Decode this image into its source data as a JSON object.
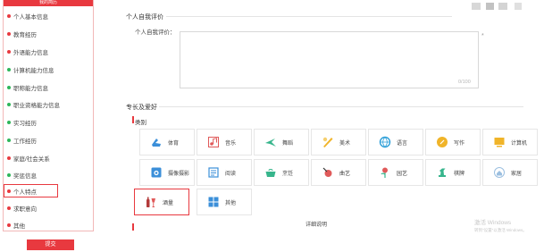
{
  "sidebar": {
    "header": "我的简历",
    "items": [
      {
        "label": "个人基本信息",
        "dot": "red"
      },
      {
        "label": "教育经历",
        "dot": "red"
      },
      {
        "label": "外语能力信息",
        "dot": "red"
      },
      {
        "label": "计算机能力信息",
        "dot": "green"
      },
      {
        "label": "职称能力信息",
        "dot": "green"
      },
      {
        "label": "职业资格能力信息",
        "dot": "green"
      },
      {
        "label": "实习经历",
        "dot": "green"
      },
      {
        "label": "工作经历",
        "dot": "green"
      },
      {
        "label": "家庭/社会关系",
        "dot": "red"
      },
      {
        "label": "奖惩信息",
        "dot": "green"
      },
      {
        "label": "个人特点",
        "dot": "red",
        "active": true
      },
      {
        "label": "求职意向",
        "dot": "red"
      },
      {
        "label": "其他",
        "dot": "red"
      }
    ],
    "submit_label": "提交"
  },
  "self_evaluation": {
    "section_title": "个人自我评价",
    "field_label": "个人自我评价：",
    "value": "",
    "char_count": "0/100",
    "required_mark": "*"
  },
  "hobbies": {
    "section_title": "专长及爱好",
    "category_label": "类别",
    "detail_label": "详细说明",
    "tiles": [
      {
        "label": "体育",
        "icon": "sports-icon",
        "color": "#3b8fd9"
      },
      {
        "label": "音乐",
        "icon": "music-icon",
        "color": "#e05a5a"
      },
      {
        "label": "舞蹈",
        "icon": "dance-icon",
        "color": "#37b58c"
      },
      {
        "label": "美术",
        "icon": "art-icon",
        "color": "#f0b429"
      },
      {
        "label": "语言",
        "icon": "language-icon",
        "color": "#2d9fd8"
      },
      {
        "label": "写作",
        "icon": "writing-icon",
        "color": "#f0b429"
      },
      {
        "label": "计算机",
        "icon": "computer-icon",
        "color": "#f0b429"
      },
      {
        "label": "摄像摄影",
        "icon": "camera-icon",
        "color": "#3b8fd9"
      },
      {
        "label": "阅读",
        "icon": "reading-icon",
        "color": "#3b8fd9"
      },
      {
        "label": "烹饪",
        "icon": "cooking-icon",
        "color": "#37b58c"
      },
      {
        "label": "曲艺",
        "icon": "opera-icon",
        "color": "#e05a5a"
      },
      {
        "label": "园艺",
        "icon": "gardening-icon",
        "color": "#e05a5a"
      },
      {
        "label": "棋牌",
        "icon": "chess-icon",
        "color": "#37b58c"
      },
      {
        "label": "家居",
        "icon": "home-icon",
        "color": "#3b8fd9"
      },
      {
        "label": "酒量",
        "icon": "wine-icon",
        "color": "#e05a5a",
        "selected": true
      },
      {
        "label": "其他",
        "icon": "other-icon",
        "color": "#3b8fd9"
      }
    ]
  },
  "watermark": {
    "line1": "激活 Windows",
    "line2": "转到\"设置\"以激活 Windows。"
  }
}
